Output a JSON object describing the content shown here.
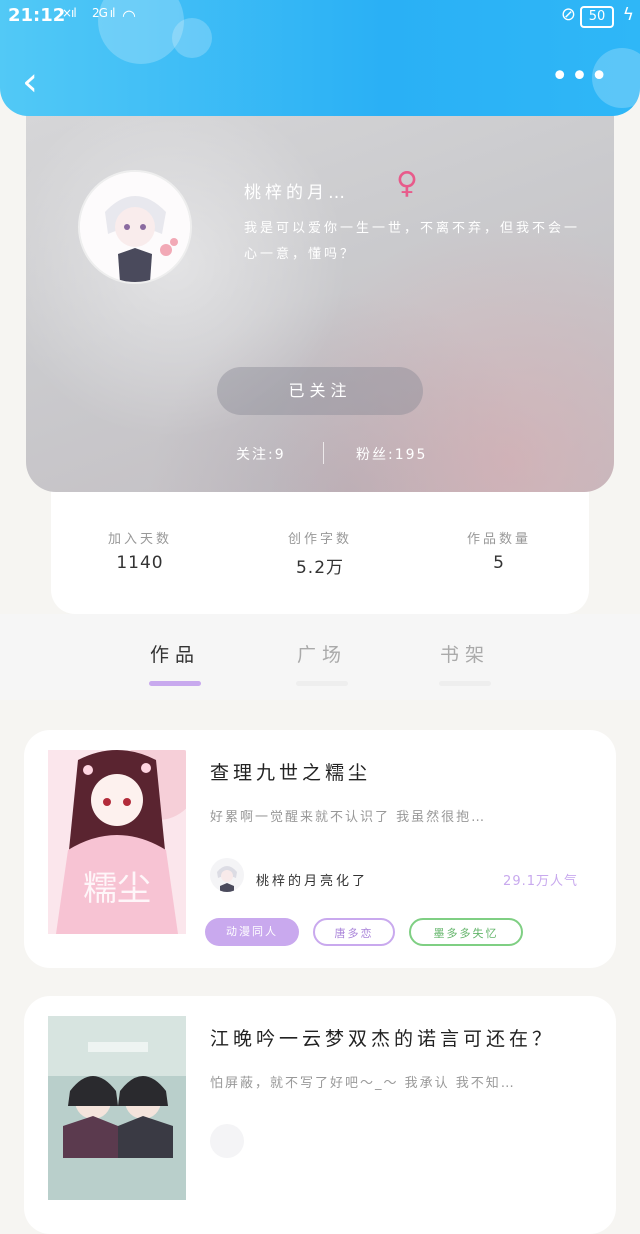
{
  "status_bar": {
    "time": "21:12",
    "signal_1": "×ıl",
    "signal_2": "2G ıl",
    "battery": "50"
  },
  "profile": {
    "nickname": "桃梓的月…",
    "gender_symbol": "♀",
    "bio": "我是可以爱你一生一世，不离不弃，但我不会一心一意，懂吗？",
    "follow_button": "已关注",
    "following": "关注:9",
    "fans": "粉丝:195"
  },
  "stats": [
    {
      "label": "加入天数",
      "value": "1140"
    },
    {
      "label": "创作字数",
      "value": "5.2万"
    },
    {
      "label": "作品数量",
      "value": "5"
    }
  ],
  "tabs": [
    {
      "label": "作品",
      "active": true
    },
    {
      "label": "广场",
      "active": false
    },
    {
      "label": "书架",
      "active": false
    }
  ],
  "books": [
    {
      "title": "查理九世之糯尘",
      "desc": "好累啊一觉醒来就不认识了 我虽然很抱…",
      "author": "桃梓的月亮化了",
      "popularity": "29.1万人气",
      "tags": [
        "动漫同人",
        "唐多恋",
        "墨多多失忆"
      ],
      "cover_text": "糯尘"
    },
    {
      "title": "江晚吟一云梦双杰的诺言可还在？",
      "desc": "怕屏蔽，就不写了好吧～_～ 我承认 我不知…"
    }
  ],
  "colors": {
    "header": "#2ab0f5",
    "accent_purple": "#c8a9ee",
    "tag_green": "#7fcf83",
    "gender": "#e85b8b"
  }
}
